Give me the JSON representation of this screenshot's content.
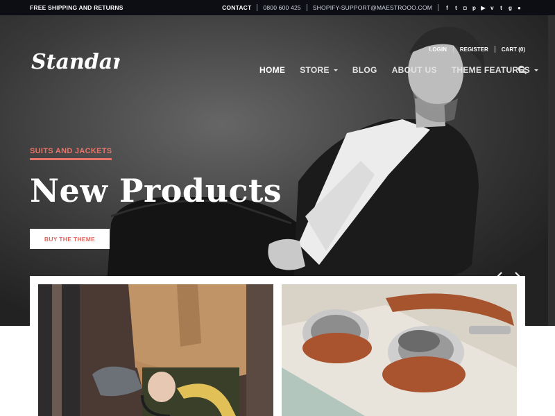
{
  "topbar": {
    "promo": "FREE SHIPPING AND RETURNS",
    "contact": "CONTACT",
    "phone": "0800 600 425",
    "email": "SHOPIFY-SUPPORT@MAESTROOO.COM",
    "social": [
      {
        "name": "facebook-icon",
        "glyph": "f"
      },
      {
        "name": "twitter-icon",
        "glyph": "t"
      },
      {
        "name": "instagram-icon",
        "glyph": "◘"
      },
      {
        "name": "pinterest-icon",
        "glyph": "p"
      },
      {
        "name": "youtube-icon",
        "glyph": "▶"
      },
      {
        "name": "vimeo-icon",
        "glyph": "v"
      },
      {
        "name": "tumblr-icon",
        "glyph": "t"
      },
      {
        "name": "googleplus-icon",
        "glyph": "g"
      },
      {
        "name": "snapchat-icon",
        "glyph": "●"
      }
    ]
  },
  "header": {
    "logo_text": "Standard.",
    "account": {
      "login": "LOGIN",
      "register": "REGISTER",
      "cart": "CART (0)"
    },
    "nav": [
      {
        "label": "HOME",
        "active": true,
        "dropdown": false
      },
      {
        "label": "STORE",
        "active": false,
        "dropdown": true
      },
      {
        "label": "BLOG",
        "active": false,
        "dropdown": false
      },
      {
        "label": "ABOUT US",
        "active": false,
        "dropdown": false
      },
      {
        "label": "THEME FEATURES",
        "active": false,
        "dropdown": true
      }
    ]
  },
  "hero": {
    "eyebrow": "SUITS AND JACKETS",
    "headline": "New Products",
    "cta": "BUY THE THEME"
  },
  "colors": {
    "accent": "#e8746a",
    "topbar": "#0d0d14",
    "hero_bg": "#3c3c3c"
  }
}
